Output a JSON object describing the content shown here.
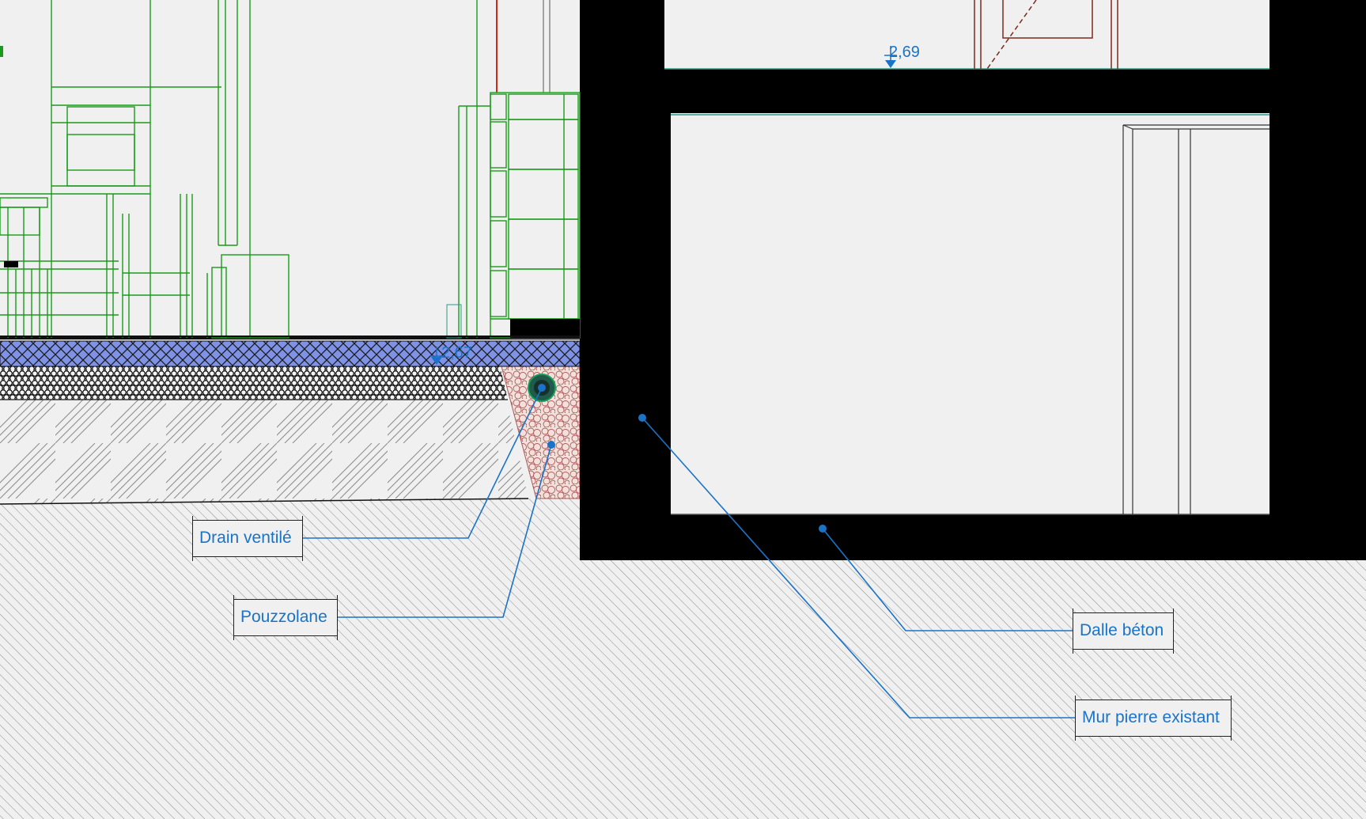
{
  "labels": {
    "drain": "Drain ventilé",
    "pouzzolane": "Pouzzolane",
    "dalle": "Dalle béton",
    "mur": "Mur pierre existant"
  },
  "levels": {
    "upper": "2,69",
    "lower": "2,67"
  },
  "colors": {
    "background": "#f0f0f0",
    "wall": "#000000",
    "annotation": "#1a73c8",
    "furniture": "#1a9a1a",
    "slab_fill": "#7a8fe0",
    "pouzzolane_fill": "#f3dcd6"
  }
}
